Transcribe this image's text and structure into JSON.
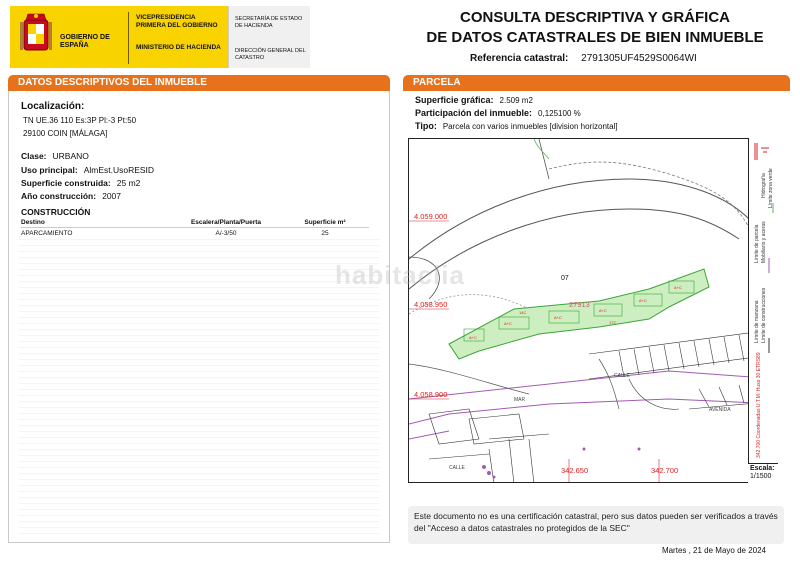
{
  "header": {
    "gov_name": "GOBIERNO DE ESPAÑA",
    "vice_presidency": "VICEPRESIDENCIA PRIMERA DEL GOBIERNO",
    "ministry": "MINISTERIO DE HACIENDA",
    "secretariat": "SECRETARÍA DE ESTADO DE HACIENDA",
    "directorate": "DIRECCIÓN GENERAL DEL CATASTRO",
    "title_line1": "CONSULTA DESCRIPTIVA Y GRÁFICA",
    "title_line2": "DE DATOS CATASTRALES DE BIEN INMUEBLE",
    "ref_label": "Referencia catastral:",
    "ref_value": "2791305UF4529S0064WI",
    "brand_colors": {
      "yellow": "#f9d300",
      "red": "#c60b1e",
      "orange": "#e8721c"
    }
  },
  "left_section": {
    "title": "DATOS DESCRIPTIVOS DEL INMUEBLE",
    "location_label": "Localización:",
    "location_line1": "TN UE.36 110 Es:3P Pl:-3 Pt:50",
    "location_line2": "29100 COIN [MÁLAGA]",
    "clase_label": "Clase:",
    "clase_value": "URBANO",
    "uso_label": "Uso principal:",
    "uso_value": "AlmEst.UsoRESID",
    "superficie_label": "Superficie construida:",
    "superficie_value": "25 m2",
    "anio_label": "Año construcción:",
    "anio_value": "2007",
    "construccion_title": "CONSTRUCCIÓN",
    "table_headers": [
      "Destino",
      "Escalera/Planta/Puerta",
      "Superficie m²"
    ],
    "table_rows": [
      [
        "APARCAMIENTO",
        "A/-3/50",
        "25"
      ]
    ]
  },
  "right_section": {
    "title": "PARCELA",
    "sup_grafica_label": "Superficie gráfica:",
    "sup_grafica_value": "2.509 m2",
    "participacion_label": "Participación del inmueble:",
    "participacion_value": "0,125100 %",
    "tipo_label": "Tipo:",
    "tipo_value": "Parcela con varios inmuebles [division horizontal]"
  },
  "map": {
    "y_labels": [
      "4.059.000",
      "4.058.950",
      "4.058.900"
    ],
    "x_labels": [
      "342.650",
      "342.700"
    ],
    "parcel_number": "07",
    "parcel_ref": "27913",
    "street_labels": [
      "MAR",
      "AVENIDA",
      "CALLE",
      "CALLE"
    ],
    "side_legend": [
      "Límite de manzana",
      "Límite de parcela",
      "Límite de construcciones",
      "Mobiliario y aceras",
      "Límite zona verde",
      "Hidrografía"
    ],
    "crs_text": "342.700 Coordenadas U.T.M. Huso 30 ETRS89",
    "scale_label": "Escala:",
    "scale_value": "1/1500",
    "parcel_fill": "#cdeec0",
    "parcel_stroke": "#3aa636",
    "boundary_color": "#a25ab6"
  },
  "watermark": "habitaclia",
  "footer": {
    "disclaimer": "Este documento no es una certificación catastral, pero sus datos pueden ser verificados a través del \"Acceso a datos catastrales no protegidos de la SEC\"",
    "date": "Martes , 21 de Mayo de 2024"
  }
}
